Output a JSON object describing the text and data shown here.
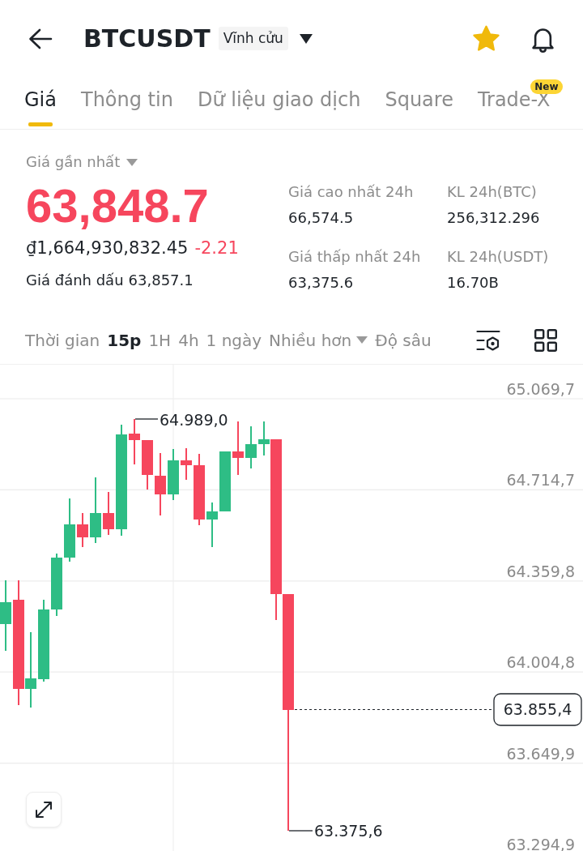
{
  "header": {
    "title": "BTCUSDT",
    "contract_type": "Vĩnh cửu",
    "favorite": true
  },
  "tabs": [
    {
      "label": "Giá",
      "selected": true
    },
    {
      "label": "Thông tin",
      "selected": false
    },
    {
      "label": "Dữ liệu giao dịch",
      "selected": false
    },
    {
      "label": "Square",
      "selected": false
    },
    {
      "label": "Trade-X",
      "selected": false,
      "badge": "New"
    }
  ],
  "price": {
    "label": "Giá gần nhất",
    "last_price": "63,848.7",
    "falling": true,
    "fiat_value": "₫1,664,930,832.45",
    "change": "-2.21",
    "mark_price_label": "Giá đánh dấu",
    "mark_price": "63,857.1"
  },
  "stats": [
    {
      "label": "Giá cao nhất 24h",
      "value": "66,574.5"
    },
    {
      "label": "KL 24h(BTC)",
      "value": "256,312.296"
    },
    {
      "label": "Giá thấp nhất 24h",
      "value": "63,375.6"
    },
    {
      "label": "KL 24h(USDT)",
      "value": "16.70B"
    }
  ],
  "timeframe_bar": {
    "label": "Thời gian",
    "intervals": [
      {
        "label": "15p",
        "selected": true
      },
      {
        "label": "1H",
        "selected": false
      },
      {
        "label": "4h",
        "selected": false
      },
      {
        "label": "1 ngày",
        "selected": false
      }
    ],
    "more": "Nhiều hơn",
    "depth": "Độ sâu"
  },
  "chart": {
    "price_axis": [
      "65.069,7",
      "64.714,7",
      "64.359,8",
      "64.004,8",
      "63.649,9",
      "63.294,9"
    ],
    "high_marker": "64.989,0",
    "low_marker": "63.375,6",
    "current_price": "63.855,4"
  }
}
